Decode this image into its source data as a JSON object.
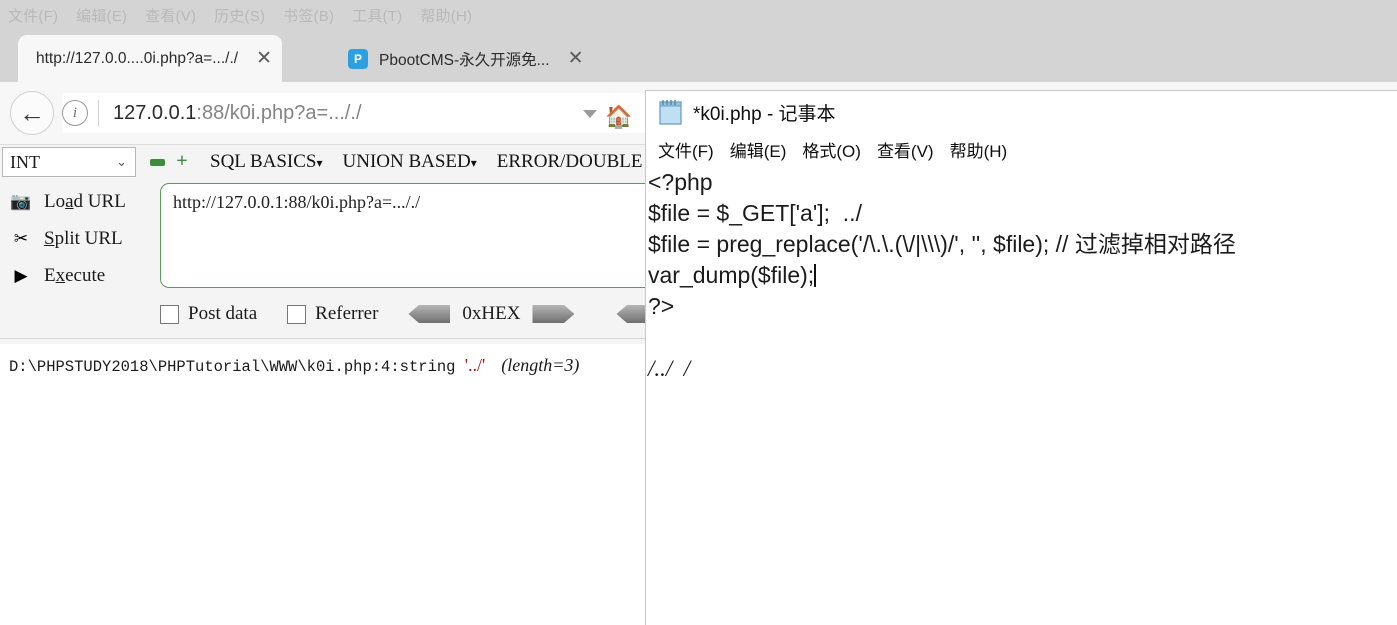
{
  "browser": {
    "menubar": [
      "文件(F)",
      "编辑(E)",
      "查看(V)",
      "历史(S)",
      "书签(B)",
      "工具(T)",
      "帮助(H)"
    ],
    "tabs": [
      {
        "title": "http://127.0.0....0i.php?a=..././",
        "close": "✕",
        "active": true,
        "favicon": ""
      },
      {
        "title": "PbootCMS-永久开源免...",
        "close": "✕",
        "active": false,
        "favicon": "P"
      }
    ],
    "new_tab_label": "+",
    "back_label": "←",
    "info_icon": "i",
    "url_host": "127.0.0.1",
    "url_rest": ":88/k0i.php?a=..././",
    "home_icon": "🏠"
  },
  "hackbar": {
    "type_select": "INT",
    "chevron": "⌄",
    "minus_label": "",
    "plus_label": "+",
    "menus": [
      "SQL BASICS",
      "UNION BASED",
      "ERROR/DOUBLE QU"
    ],
    "menu_caret": "▾",
    "actions": [
      {
        "icon": "📷",
        "label_pre": "Lo",
        "label_key": "a",
        "label_post": "d URL"
      },
      {
        "icon": "✂",
        "label_pre": "",
        "label_key": "S",
        "label_post": "plit URL"
      },
      {
        "icon": "▶",
        "label_pre": "E",
        "label_key": "x",
        "label_post": "ecute"
      }
    ],
    "url_value": "http://127.0.0.1:88/k0i.php?a=..././",
    "post_data_label": "Post data",
    "referrer_label": "Referrer",
    "hex_label": "0xHEX"
  },
  "page": {
    "vardump_path": "D:\\PHPSTUDY2018\\PHPTutorial\\WWW\\k0i.php:4:string",
    "vardump_value": "'../'",
    "vardump_length": "(length=3)"
  },
  "notepad": {
    "title": "*k0i.php - 记事本",
    "menu": [
      "文件(F)",
      "编辑(E)",
      "格式(O)",
      "查看(V)",
      "帮助(H)"
    ],
    "code_lines": [
      "<?php",
      "$file = $_GET['a'];  ../",
      "$file = preg_replace('/\\.\\.(\\/|\\\\\\)/', '', $file); // 过滤掉相对路径",
      "var_dump($file);",
      "?>"
    ],
    "result_line": "/../  /"
  }
}
